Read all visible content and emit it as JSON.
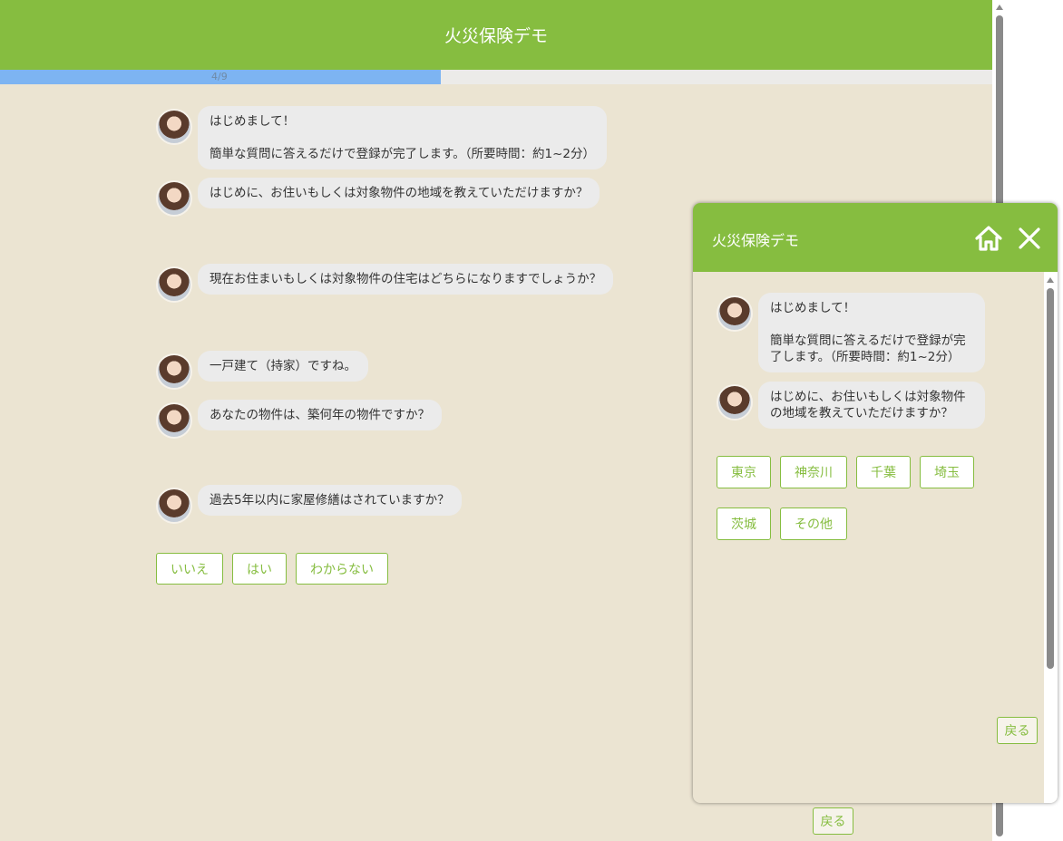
{
  "app": {
    "title": "火災保険デモ"
  },
  "progress": {
    "label": "4/9",
    "fraction": 0.444
  },
  "chat": {
    "m1_line1": "はじめまして！",
    "m1_line2": "簡単な質問に答えるだけで登録が完了します。（所要時間：約1~2分）",
    "m2": "はじめに、お住いもしくは対象物件の地域を教えていただけますか？",
    "m3": "現在お住まいもしくは対象物件の住宅はどちらになりますでしょうか？",
    "m4": "一戸建て（持家）ですね。",
    "m5": "あなたの物件は、築何年の物件ですか？",
    "m6": "過去5年以内に家屋修繕はされていますか？"
  },
  "answers": [
    "いいえ",
    "はい",
    "わからない"
  ],
  "back_label": "戻る",
  "widget": {
    "title": "火災保険デモ",
    "m1_line1": "はじめまして！",
    "m1_line2a": "簡単な質問に答えるだけで登録が完",
    "m1_line2b": "了します。（所要時間：約1~2分）",
    "m2_line1": "はじめに、お住いもしくは対象物件",
    "m2_line2": "の地域を教えていただけますか？",
    "regions": [
      "東京",
      "神奈川",
      "千葉",
      "埼玉",
      "茨城",
      "その他"
    ],
    "back_label": "戻る"
  },
  "colors": {
    "accent": "#86bd40",
    "background": "#ebe4d2",
    "progress": "#7db4f2"
  },
  "icons": {
    "home": "home-icon",
    "close": "close-icon",
    "avatar": "operator-avatar"
  }
}
